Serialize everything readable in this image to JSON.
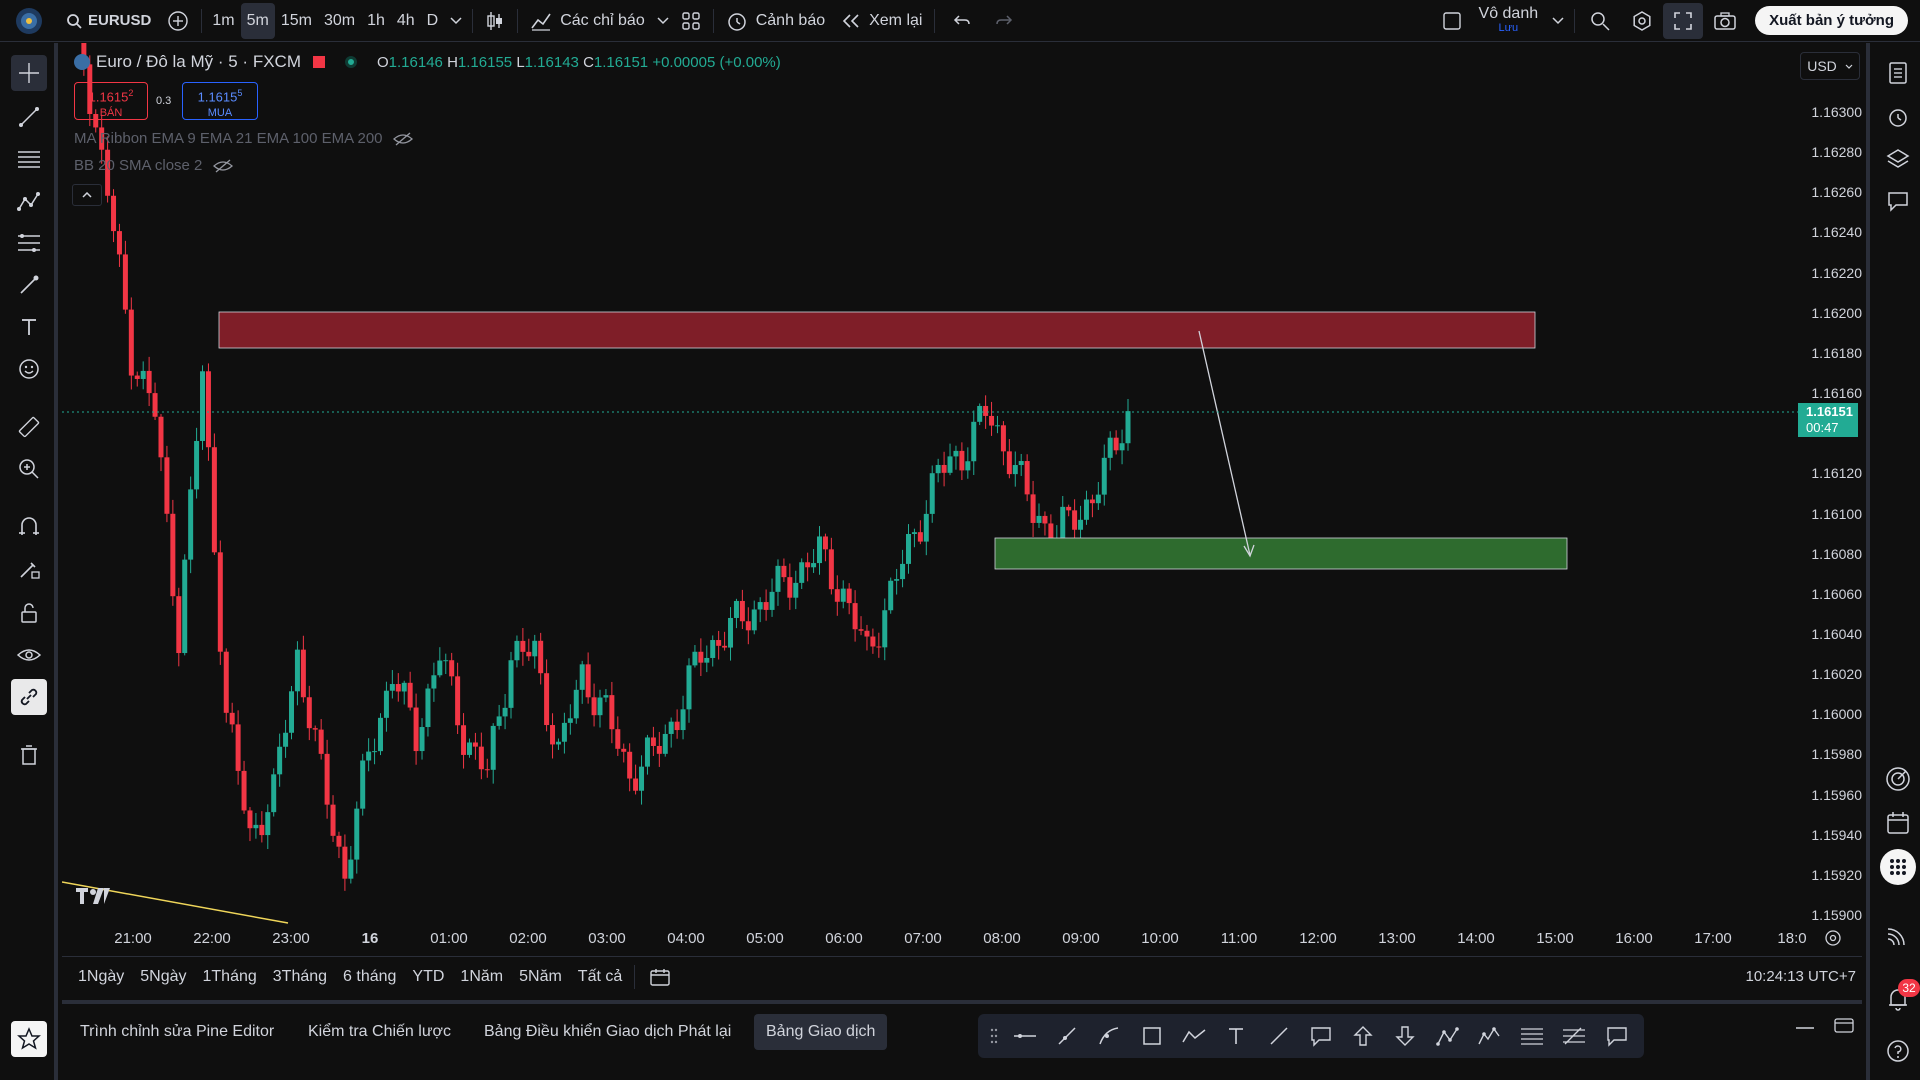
{
  "topbar": {
    "symbol": "EURUSD",
    "timeframes": [
      "1m",
      "5m",
      "15m",
      "30m",
      "1h",
      "4h",
      "D"
    ],
    "active_timeframe": "5m",
    "indicators_label": "Các chỉ báo",
    "alert_label": "Cảnh báo",
    "replay_label": "Xem lại",
    "layout_name": "Vô danh",
    "layout_status": "Lưu",
    "publish_label": "Xuất bản ý tưởng"
  },
  "legend": {
    "title": "Euro / Đô la Mỹ · 5 · FXCM",
    "o_label": "O",
    "o_val": "1.16146",
    "h_label": "H",
    "h_val": "1.16155",
    "l_label": "L",
    "l_val": "1.16143",
    "c_label": "C",
    "c_val": "1.16151",
    "change": "+0.00005 (+0.00%)"
  },
  "bid": {
    "price": "1.1615",
    "sup": "2",
    "label": "BÁN"
  },
  "ask": {
    "price": "1.1615",
    "sup": "5",
    "label": "MUA"
  },
  "spread": "0.3",
  "indicators": [
    "MA Ribbon EMA 9 EMA 21 EMA 100 EMA 200",
    "BB 20 SMA close 2"
  ],
  "price_axis": {
    "currency": "USD",
    "ticks": [
      "1.16300",
      "1.16280",
      "1.16260",
      "1.16240",
      "1.16220",
      "1.16200",
      "1.16180",
      "1.16160",
      "1.16120",
      "1.16100",
      "1.16080",
      "1.16060",
      "1.16040",
      "1.16020",
      "1.16000",
      "1.15980",
      "1.15960",
      "1.15940",
      "1.15920",
      "1.15900"
    ],
    "last_price": "1.16151",
    "countdown": "00:47"
  },
  "time_axis": [
    "21:00",
    "22:00",
    "23:00",
    "16",
    "01:00",
    "02:00",
    "03:00",
    "04:00",
    "05:00",
    "06:00",
    "07:00",
    "08:00",
    "09:00",
    "10:00",
    "11:00",
    "12:00",
    "13:00",
    "14:00",
    "15:00",
    "16:00",
    "17:00",
    "18:0"
  ],
  "ranges": [
    "1Ngày",
    "5Ngày",
    "1Tháng",
    "3Tháng",
    "6 tháng",
    "YTD",
    "1Năm",
    "5Năm",
    "Tất cả"
  ],
  "clock": "10:24:13 UTC+7",
  "bottom_tabs": [
    "Trình chỉnh sửa Pine Editor",
    "Kiểm tra Chiến lược",
    "Bảng Điều khiển Giao dịch Phát lại",
    "Bảng Giao dịch"
  ],
  "active_bottom_tab": "Bảng Giao dịch",
  "notifications_count": "32",
  "chart_data": {
    "type": "candlestick",
    "x_labels": [
      "21:00",
      "22:00",
      "23:00",
      "16",
      "01:00",
      "02:00",
      "03:00",
      "04:00",
      "05:00",
      "06:00",
      "07:00",
      "08:00",
      "09:00",
      "10:00"
    ],
    "ylim": [
      1.159,
      1.1632
    ],
    "last_close": 1.16151,
    "zones": [
      {
        "type": "resistance",
        "from": 1.16182,
        "to": 1.162,
        "color": "#7f1e28"
      },
      {
        "type": "support",
        "from": 1.16075,
        "to": 1.1609,
        "color": "#2e6b2e"
      }
    ],
    "arrow": {
      "from_price": 1.1619,
      "to_price": 1.16082
    },
    "colors": {
      "up": "#22ab94",
      "down": "#f23645"
    }
  }
}
